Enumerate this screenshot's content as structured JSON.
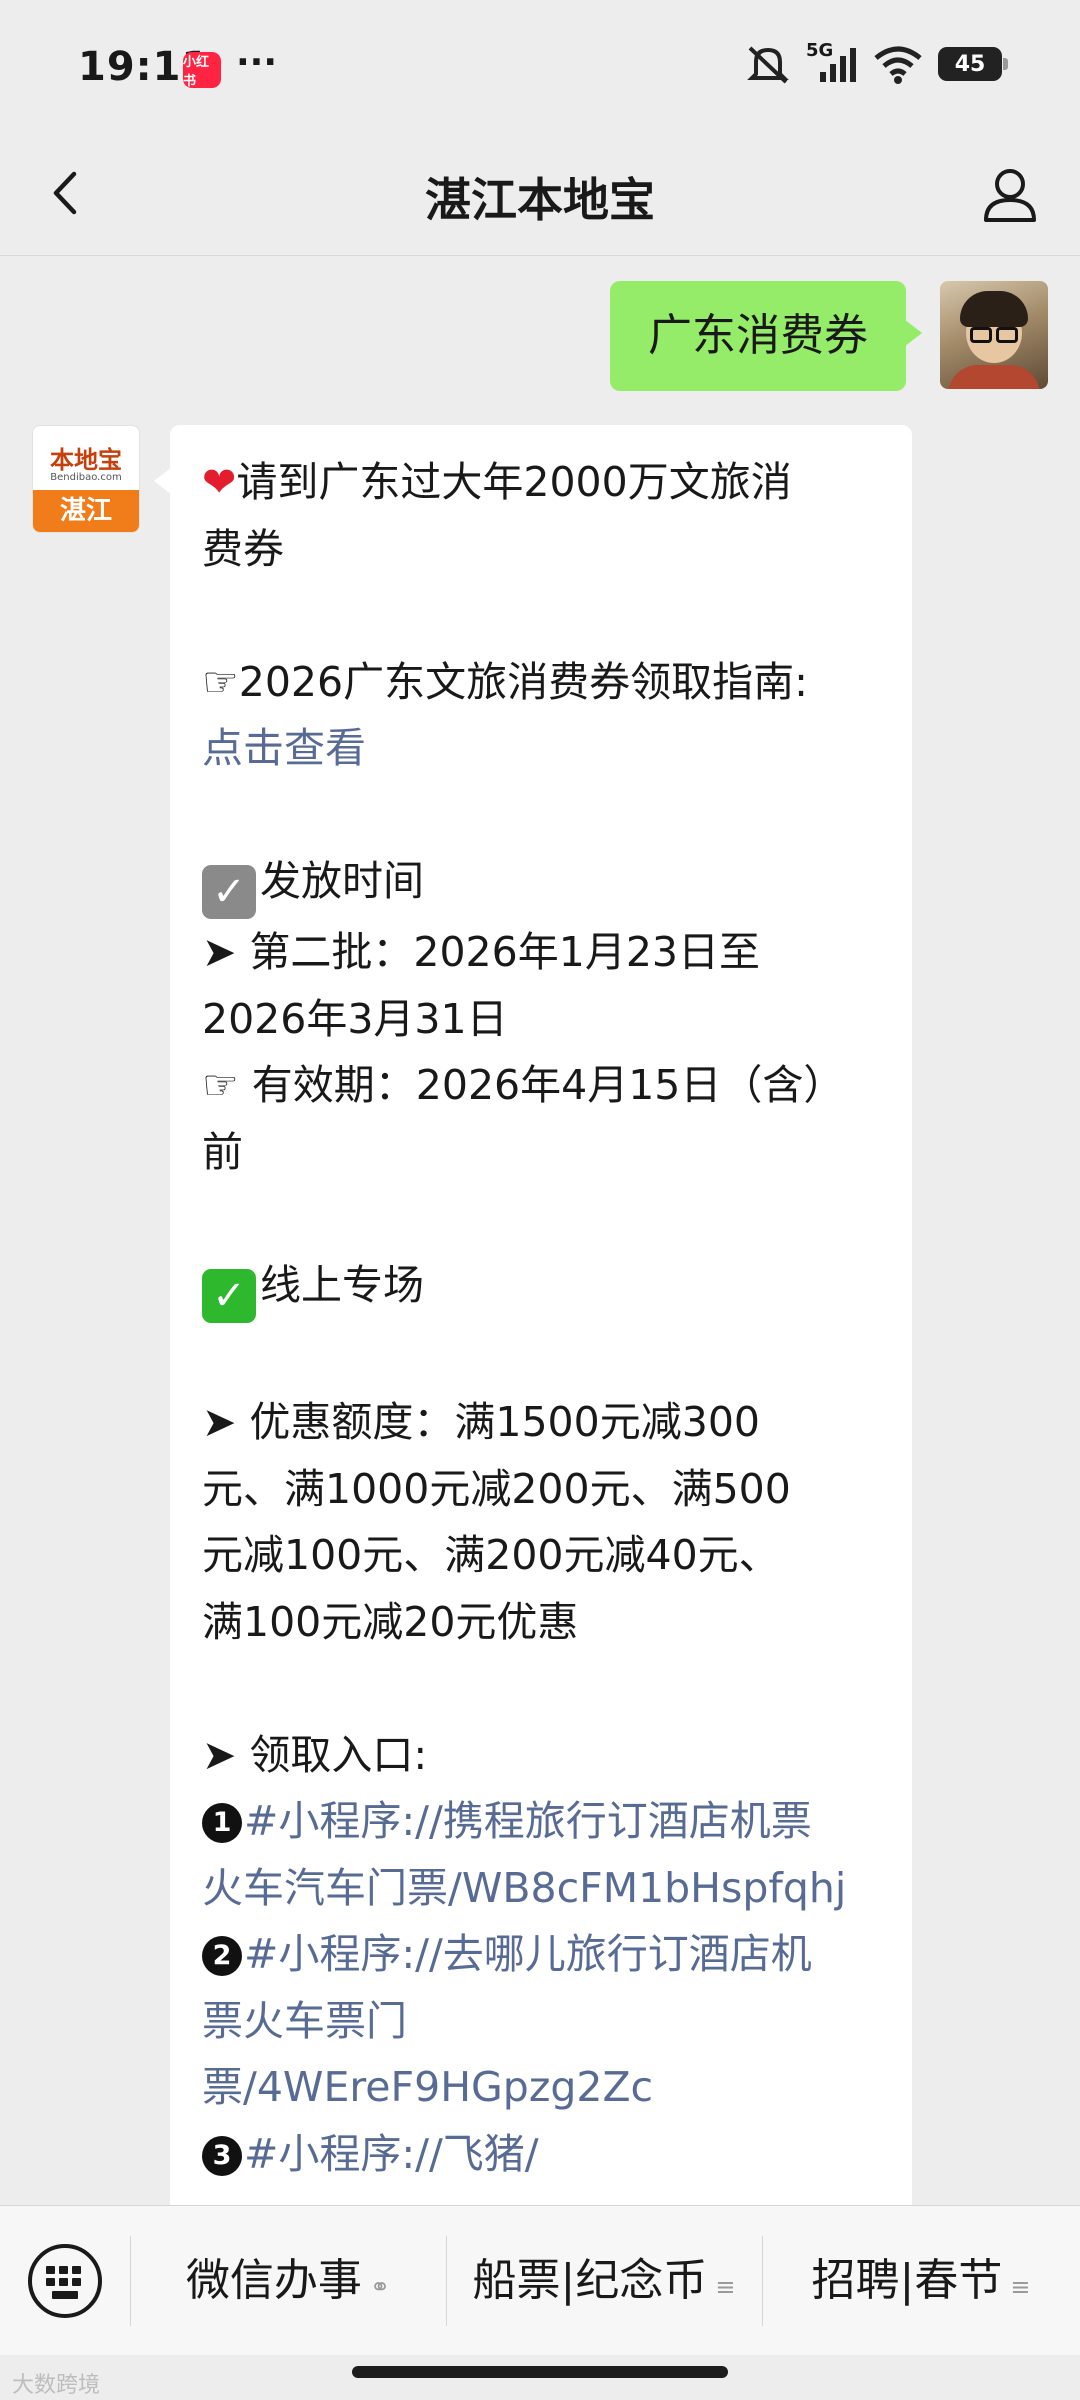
{
  "status_bar": {
    "time": "19:11",
    "notif_app": "小红书",
    "battery": "45",
    "network": "5G"
  },
  "nav": {
    "title": "湛江本地宝"
  },
  "user_message": "广东消费券",
  "bot_avatar": {
    "logo": "本地宝",
    "site": "Bendibao.com",
    "city": "湛江"
  },
  "bot_message": {
    "l1": "请到广东过大年2000万文旅消",
    "l2": "费券",
    "l3": "☞2026广东文旅消费券领取指南:",
    "l4_link": "点击查看",
    "l5": "发放时间",
    "l6": "➤ 第二批：2026年1月23日至",
    "l7": "2026年3月31日",
    "l8": "☞ 有效期：2026年4月15日（含）",
    "l9": "前",
    "l10": "线上专场",
    "l11": "➤ 优惠额度：满1500元减300",
    "l12": "元、满1000元减200元、满500",
    "l13": "元减100元、满200元减40元、",
    "l14": "满100元减20元优惠",
    "l15": "➤ 领取入口:",
    "e1_num": "1",
    "e1a": "#小程序://携程旅行订酒店机票",
    "e1b": "火车汽车门票/WB8cFM1bHspfqhj",
    "e2_num": "2",
    "e2a": "#小程序://去哪儿旅行订酒店机",
    "e2b": "票火车票门",
    "e2c": "票/4WEreF9HGpzg2Zc",
    "e3_num": "3",
    "e3a": "#小程序://飞猪/"
  },
  "menu": {
    "item1": "微信办事",
    "item2": "船票|纪念币",
    "item3": "招聘|春节"
  },
  "watermark": "大数跨境"
}
